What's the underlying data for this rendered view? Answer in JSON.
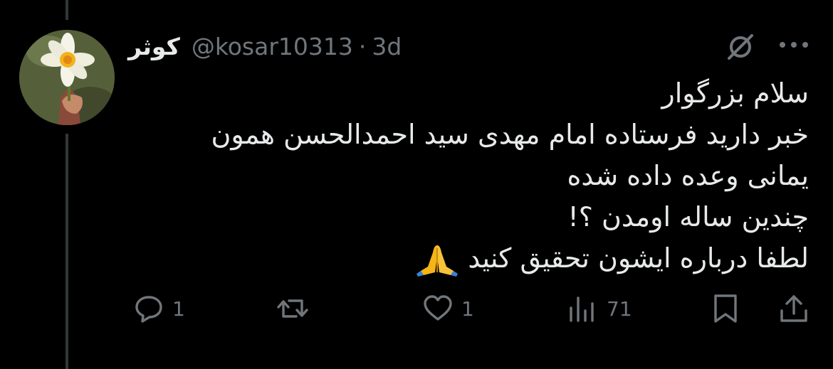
{
  "tweet": {
    "display_name": "کوثر",
    "handle": "@kosar10313",
    "separator": "·",
    "timestamp": "3d",
    "body_lines": [
      "سلام بزرگوار",
      "خبر دارید فرستاده امام مهدی سید احمدالحسن همون",
      "یمانی وعده داده شده",
      "چندین ساله اومدن ؟!",
      "لطفا درباره ایشون تحقیق کنید"
    ],
    "emoji": "pray-emoji"
  },
  "actions": {
    "reply_count": "1",
    "retweet_count": "",
    "like_count": "1",
    "view_count": "71"
  },
  "icons": {
    "grok": "grok-icon",
    "more": "more-icon",
    "reply": "reply-icon",
    "retweet": "retweet-icon",
    "like": "like-icon",
    "views": "views-icon",
    "bookmark": "bookmark-icon",
    "share": "share-icon"
  },
  "colors": {
    "background": "#000000",
    "text": "#e7e9ea",
    "secondary": "#71767b",
    "thread_line": "#333639"
  }
}
